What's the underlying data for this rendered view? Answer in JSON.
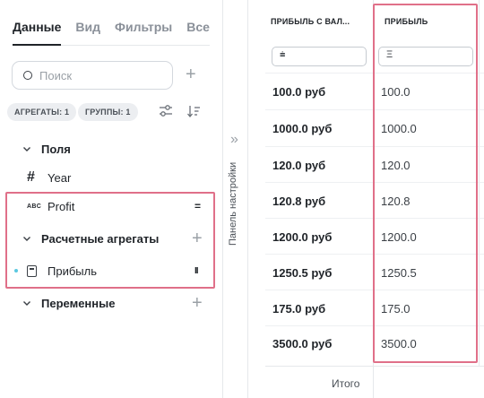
{
  "left_panel": {
    "tabs": [
      "Данные",
      "Вид",
      "Фильтры",
      "Все"
    ],
    "search": {
      "placeholder": "Поиск"
    },
    "chips": [
      "АГРЕГАТЫ: 1",
      "ГРУППЫ: 1"
    ],
    "sections": {
      "fields": "Поля",
      "field_year": "Year",
      "field_profit": "Profit",
      "field_profit_type": "ABC",
      "calc_aggregates": "Расчетные агрегаты",
      "calc_profit": "Прибыль",
      "variables": "Переменные"
    },
    "icons": {
      "search": "search-icon",
      "add": "plus-icon",
      "tune": "sliders-icon",
      "sort": "sort-icon",
      "chevron": "chevron-down-icon"
    }
  },
  "strip": {
    "label": "Панель настройки"
  },
  "grid": {
    "columns": [
      "ПРИБЫЛЬ С ВАЛ...",
      "ПРИБЫЛЬ"
    ],
    "rows": [
      [
        "100.0 руб",
        "100.0"
      ],
      [
        "1000.0 руб",
        "1000.0"
      ],
      [
        "120.0 руб",
        "120.0"
      ],
      [
        "120.8 руб",
        "120.8"
      ],
      [
        "1200.0 руб",
        "1200.0"
      ],
      [
        "1250.5 руб",
        "1250.5"
      ],
      [
        "175.0 руб",
        "175.0"
      ],
      [
        "3500.0 руб",
        "3500.0"
      ]
    ],
    "footer_label": "Итого"
  },
  "colors": {
    "highlight": "#e07089",
    "accent_dot": "#5ac8e0"
  }
}
